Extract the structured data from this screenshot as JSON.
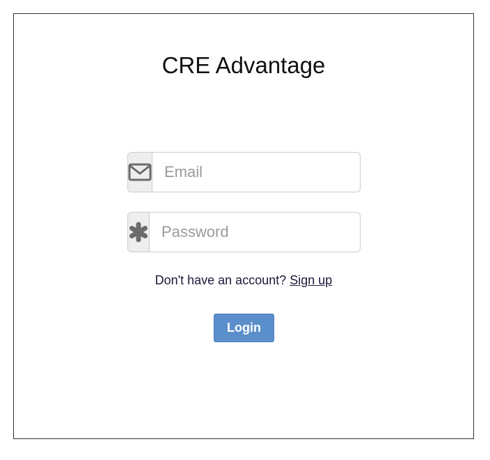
{
  "app": {
    "title": "CRE Advantage"
  },
  "form": {
    "email": {
      "placeholder": "Email",
      "value": "",
      "icon": "envelope-icon"
    },
    "password": {
      "placeholder": "Password",
      "value": "",
      "icon": "asterisk-icon"
    },
    "signup_prompt": "Don't have an account?",
    "signup_link": "Sign up",
    "login_label": "Login"
  },
  "colors": {
    "button_bg": "#5b8fcc",
    "addon_bg": "#eeeeee",
    "icon_color": "#6b6b6b"
  }
}
